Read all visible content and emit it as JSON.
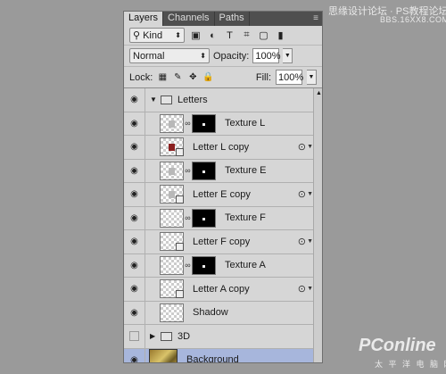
{
  "watermarks": {
    "top_line1": "思缘设计论坛 · PS教程论坛",
    "top_line2": "BBS.16XX8.COM",
    "bottom_brand": "PConline",
    "bottom_sub": "太 平 洋 电 脑 网"
  },
  "tabs": [
    {
      "label": "Layers",
      "active": true
    },
    {
      "label": "Channels",
      "active": false
    },
    {
      "label": "Paths",
      "active": false
    }
  ],
  "filter": {
    "kind_label": "Kind",
    "kind_icon": "search-icon"
  },
  "blend": {
    "mode": "Normal",
    "opacity_label": "Opacity:",
    "opacity": "100%"
  },
  "lock": {
    "label": "Lock:",
    "fill_label": "Fill:",
    "fill": "100%"
  },
  "layers": [
    {
      "name": "Letters",
      "kind": "group-open",
      "visible": true
    },
    {
      "name": "Texture L",
      "kind": "masked",
      "visible": true
    },
    {
      "name": "Letter L copy",
      "kind": "smart-fx",
      "visible": true
    },
    {
      "name": "Texture E",
      "kind": "masked",
      "visible": true
    },
    {
      "name": "Letter E copy",
      "kind": "smart-fx",
      "visible": true
    },
    {
      "name": "Texture F",
      "kind": "masked",
      "visible": true
    },
    {
      "name": "Letter F copy",
      "kind": "smart-fx",
      "visible": true
    },
    {
      "name": "Texture A",
      "kind": "masked",
      "visible": true
    },
    {
      "name": "Letter A copy",
      "kind": "smart-fx",
      "visible": true
    },
    {
      "name": "Shadow",
      "kind": "plain",
      "visible": true
    },
    {
      "name": "3D",
      "kind": "group-closed",
      "visible": false
    },
    {
      "name": "Background",
      "kind": "background",
      "visible": true,
      "selected": true
    }
  ],
  "colors": {
    "selected_row": "#a7b6dc",
    "panel_bg": "#d6d6d6",
    "tab_bar": "#4f4f4f"
  }
}
